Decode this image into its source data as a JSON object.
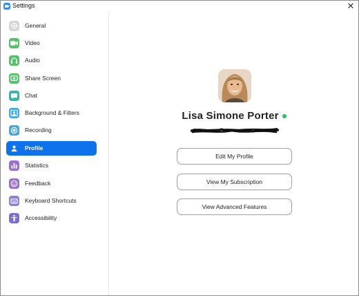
{
  "window": {
    "title": "Settings",
    "close_glyph": "✕"
  },
  "sidebar": {
    "items": [
      {
        "label": "General",
        "icon": "gear-icon",
        "color": "#cfcfcf",
        "active": false
      },
      {
        "label": "Video",
        "icon": "video-icon",
        "color": "#55c26b",
        "active": false
      },
      {
        "label": "Audio",
        "icon": "headphones-icon",
        "color": "#55c26b",
        "active": false
      },
      {
        "label": "Share Screen",
        "icon": "share-screen-icon",
        "color": "#55c26b",
        "active": false
      },
      {
        "label": "Chat",
        "icon": "chat-icon",
        "color": "#2eb8a6",
        "active": false
      },
      {
        "label": "Background & Filters",
        "icon": "background-icon",
        "color": "#3fa9e0",
        "active": false
      },
      {
        "label": "Recording",
        "icon": "record-icon",
        "color": "#3fa9e0",
        "active": false
      },
      {
        "label": "Profile",
        "icon": "profile-icon",
        "color": "#0e72ed",
        "active": true
      },
      {
        "label": "Statistics",
        "icon": "statistics-icon",
        "color": "#9b6fd1",
        "active": false
      },
      {
        "label": "Feedback",
        "icon": "feedback-icon",
        "color": "#9b6fd1",
        "active": false
      },
      {
        "label": "Keyboard Shortcuts",
        "icon": "keyboard-icon",
        "color": "#8a84d6",
        "active": false
      },
      {
        "label": "Accessibility",
        "icon": "accessibility-icon",
        "color": "#7a6fd1",
        "active": false
      }
    ]
  },
  "profile": {
    "name": "Lisa Simone Porter",
    "status_color": "#23c16b",
    "buttons": {
      "edit": "Edit My Profile",
      "subscription": "View My Subscription",
      "advanced": "View Advanced Features"
    }
  }
}
